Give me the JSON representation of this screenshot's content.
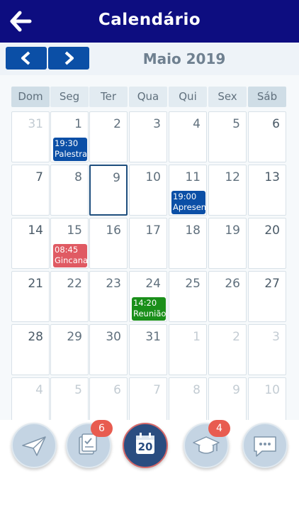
{
  "header": {
    "title": "Calendário"
  },
  "calendar": {
    "month": "Maio 2019",
    "weekdays": [
      "Dom",
      "Seg",
      "Ter",
      "Qua",
      "Qui",
      "Sex",
      "Sáb"
    ],
    "weeks": [
      [
        {
          "day": "31",
          "muted": true
        },
        {
          "day": "1",
          "event": {
            "time": "19:30",
            "title": "Palestra",
            "color": "#0b4fa6"
          }
        },
        {
          "day": "2"
        },
        {
          "day": "3"
        },
        {
          "day": "4"
        },
        {
          "day": "5"
        },
        {
          "day": "6"
        }
      ],
      [
        {
          "day": "7"
        },
        {
          "day": "8"
        },
        {
          "day": "9",
          "selected": true
        },
        {
          "day": "10"
        },
        {
          "day": "11",
          "event": {
            "time": "19:00",
            "title": "Apresen",
            "color": "#0b4fa6"
          }
        },
        {
          "day": "12"
        },
        {
          "day": "13"
        }
      ],
      [
        {
          "day": "14"
        },
        {
          "day": "15",
          "event": {
            "time": "08:45",
            "title": "Gincana",
            "color": "#e05a63"
          }
        },
        {
          "day": "16"
        },
        {
          "day": "17"
        },
        {
          "day": "18"
        },
        {
          "day": "19"
        },
        {
          "day": "20"
        }
      ],
      [
        {
          "day": "21"
        },
        {
          "day": "22"
        },
        {
          "day": "23"
        },
        {
          "day": "24",
          "event": {
            "time": "14:20",
            "title": "Reunião",
            "color": "#1a8f1a"
          }
        },
        {
          "day": "25"
        },
        {
          "day": "26"
        },
        {
          "day": "27"
        }
      ],
      [
        {
          "day": "28"
        },
        {
          "day": "29"
        },
        {
          "day": "30"
        },
        {
          "day": "31"
        },
        {
          "day": "1",
          "muted": true
        },
        {
          "day": "2",
          "muted": true
        },
        {
          "day": "3",
          "muted": true
        }
      ],
      [
        {
          "day": "4",
          "muted": true
        },
        {
          "day": "5",
          "muted": true
        },
        {
          "day": "6",
          "muted": true
        },
        {
          "day": "7",
          "muted": true
        },
        {
          "day": "8",
          "muted": true
        },
        {
          "day": "9",
          "muted": true
        },
        {
          "day": "10",
          "muted": true
        }
      ]
    ]
  },
  "bottom_nav": [
    {
      "name": "messages-nav-button",
      "icon": "paper-plane-icon",
      "badge": null
    },
    {
      "name": "tasks-nav-button",
      "icon": "checklist-icon",
      "badge": "6"
    },
    {
      "name": "calendar-nav-button",
      "icon": "calendar-icon",
      "label": "20",
      "badge": null,
      "active": true
    },
    {
      "name": "grades-nav-button",
      "icon": "graduation-cap-icon",
      "badge": "4"
    },
    {
      "name": "chat-nav-button",
      "icon": "chat-bubble-icon",
      "badge": null
    }
  ]
}
